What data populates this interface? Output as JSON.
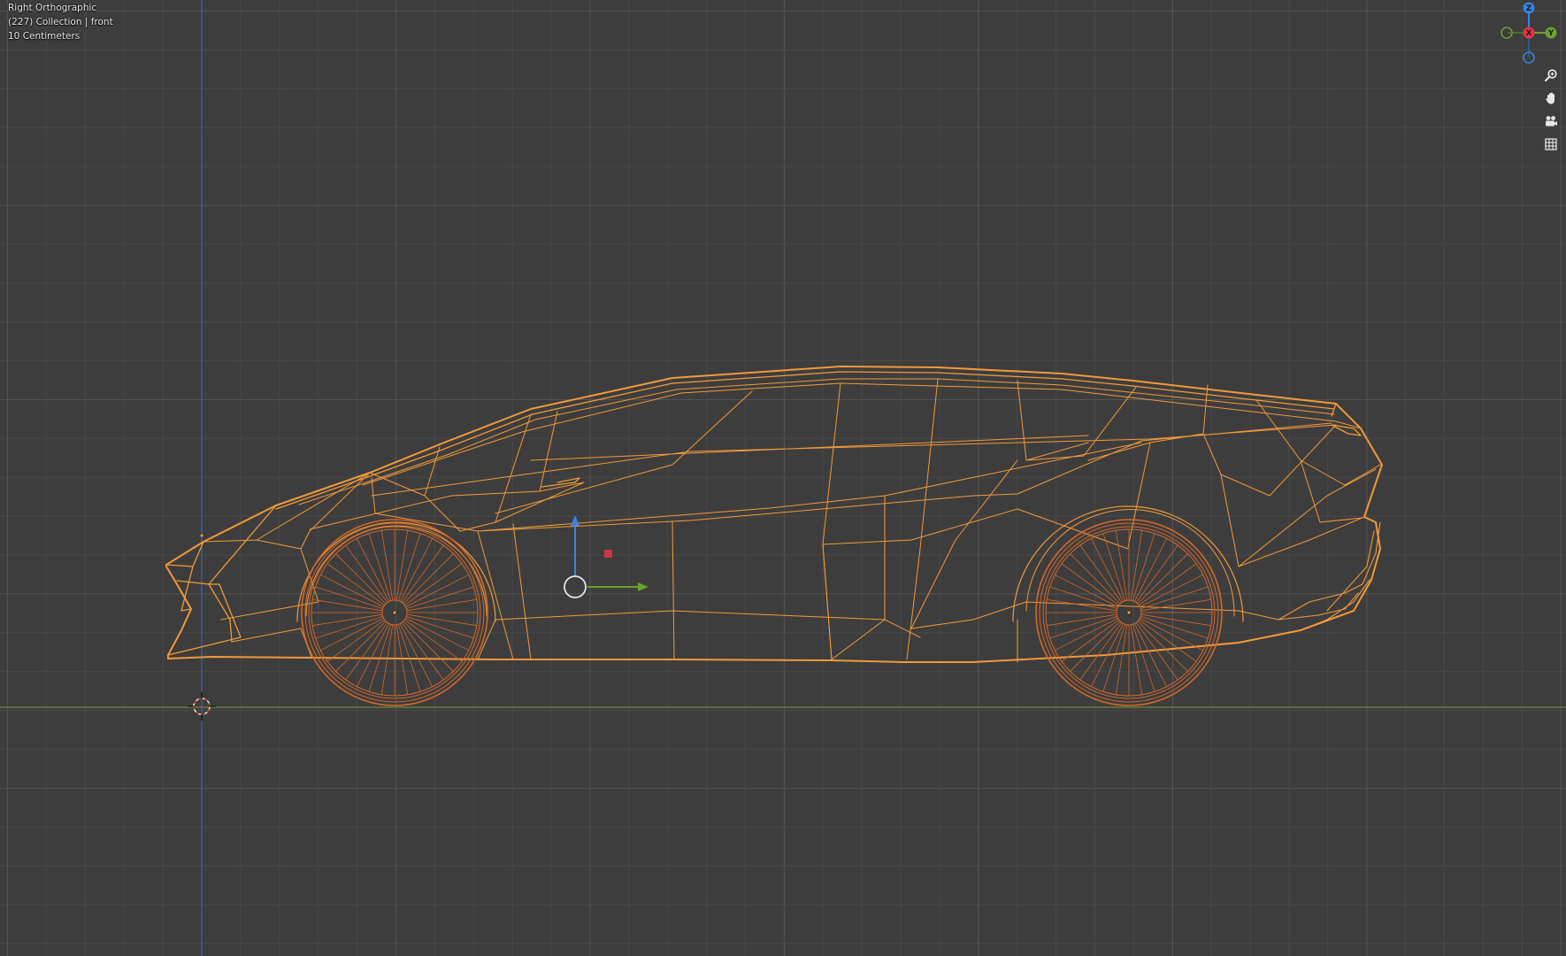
{
  "viewport": {
    "view_name": "Right Orthographic",
    "collection_label": "(227) Collection | front",
    "grid_scale_label": "10 Centimeters"
  },
  "gizmo": {
    "z_label": "Z",
    "x_label": "X",
    "y_label": "Y"
  },
  "tools": [
    {
      "icon": "zoom-icon"
    },
    {
      "icon": "hand-pan-icon"
    },
    {
      "icon": "camera-icon"
    },
    {
      "icon": "grid-ortho-icon"
    }
  ],
  "colors": {
    "background": "#3d3d3d",
    "wire_selected": "#f29a3a",
    "wheel_wire": "#d4682a",
    "axis_x": "#e8334a",
    "axis_y": "#6ca12f",
    "axis_z": "#3b83e0",
    "horizon_line": "#6c8a3a"
  }
}
